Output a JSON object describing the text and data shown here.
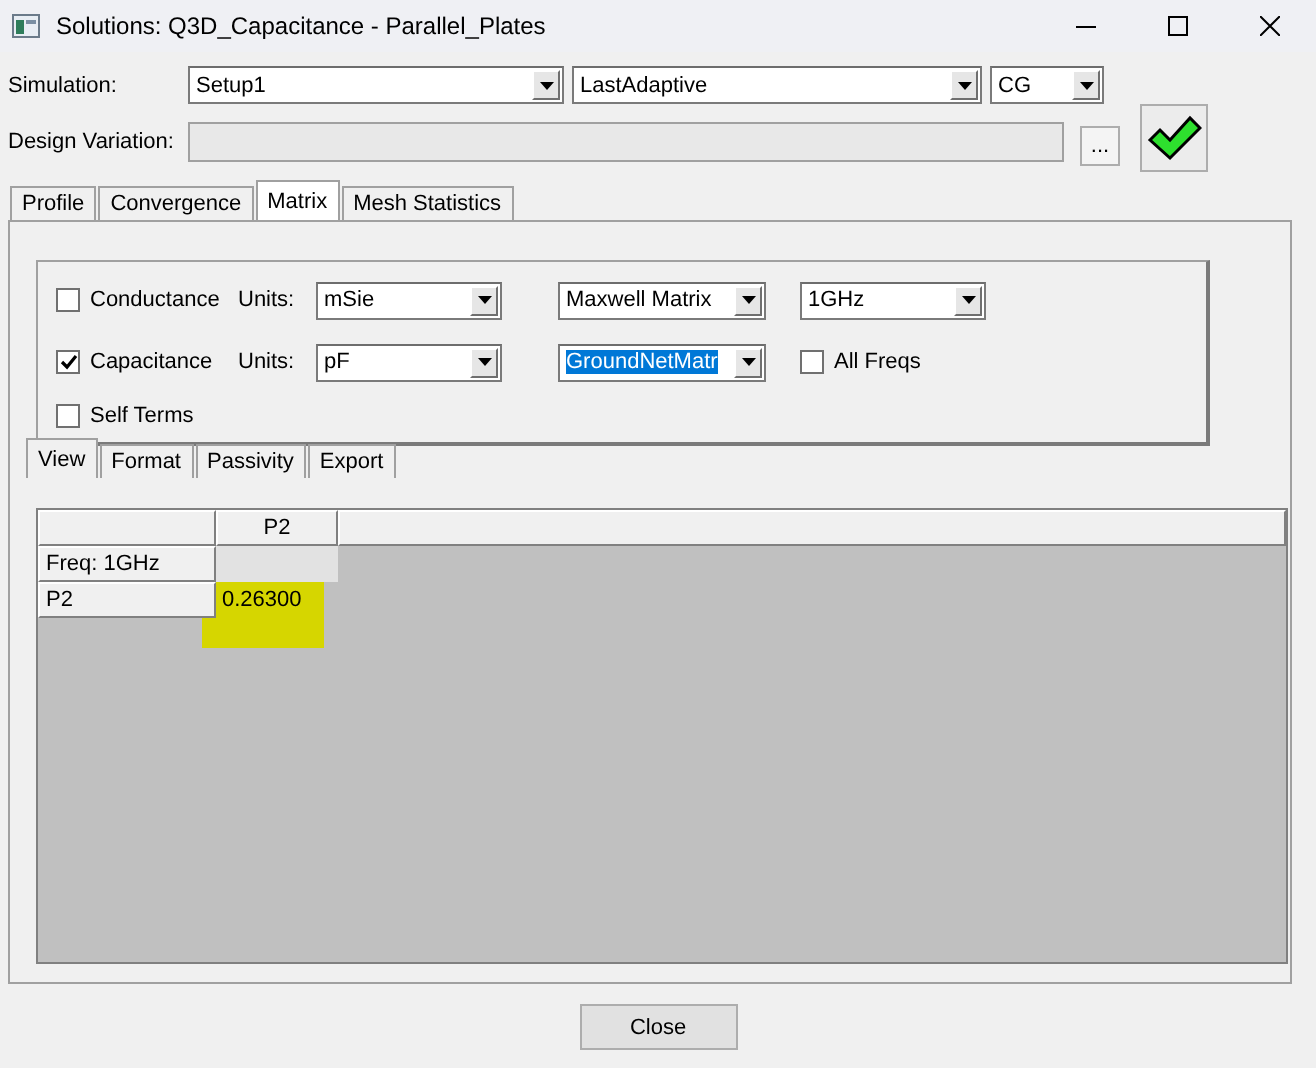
{
  "window": {
    "title": "Solutions: Q3D_Capacitance - Parallel_Plates"
  },
  "simulation": {
    "label": "Simulation:",
    "setup": "Setup1",
    "solution": "LastAdaptive",
    "type": "CG"
  },
  "design_variation": {
    "label": "Design Variation:",
    "browse_button": "..."
  },
  "tabs": [
    {
      "label": "Profile",
      "selected": false
    },
    {
      "label": "Convergence",
      "selected": false
    },
    {
      "label": "Matrix",
      "selected": true
    },
    {
      "label": "Mesh Statistics",
      "selected": false
    }
  ],
  "options": [
    {
      "label": "Conductance",
      "checked": false,
      "units_label": "Units:",
      "units": "mSie",
      "matrix": "Maxwell Matrix",
      "matrix_focused": false,
      "extra": {
        "kind": "dropdown",
        "value": "1GHz"
      }
    },
    {
      "label": "Capacitance",
      "checked": true,
      "units_label": "Units:",
      "units": "pF",
      "matrix": "GroundNetMatr",
      "matrix_focused": true,
      "extra": {
        "kind": "checkbox",
        "label": "All Freqs",
        "checked": false
      }
    }
  ],
  "self_terms": {
    "label": "Self Terms",
    "checked": false
  },
  "sub_tabs": [
    {
      "label": "View",
      "selected": true
    },
    {
      "label": "Format",
      "selected": false
    },
    {
      "label": "Passivity",
      "selected": false
    },
    {
      "label": "Export",
      "selected": false
    }
  ],
  "grid": {
    "columns": [
      "P2"
    ],
    "rows": [
      {
        "kind": "freq",
        "label": "Freq: 1GHz"
      },
      {
        "kind": "value",
        "label": "P2",
        "values": [
          "0.26300"
        ],
        "highlighted": true
      }
    ]
  },
  "close_button": "Close"
}
